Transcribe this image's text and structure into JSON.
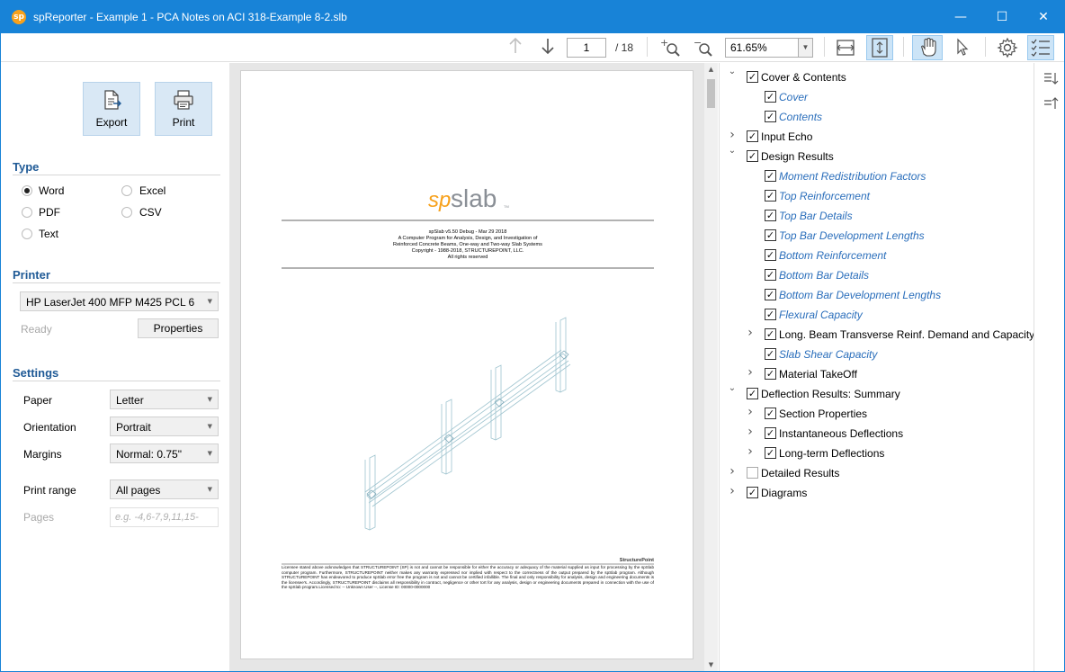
{
  "window": {
    "title": "spReporter - Example 1 - PCA Notes on ACI 318-Example 8-2.slb",
    "app_icon": "sp",
    "minimize": "—",
    "maximize": "☐",
    "close": "✕"
  },
  "toolbar": {
    "page_current": "1",
    "page_total": "/ 18",
    "zoom": "61.65%",
    "icons": [
      "arrow-up-icon",
      "arrow-down-icon",
      "zoom-in-icon",
      "zoom-out-icon",
      "fit-width-icon",
      "fit-page-icon",
      "hand-icon",
      "pointer-icon",
      "gear-icon",
      "checklist-icon"
    ]
  },
  "left": {
    "export_label": "Export",
    "print_label": "Print",
    "type_title": "Type",
    "types": [
      {
        "label": "Word",
        "checked": true
      },
      {
        "label": "Excel",
        "checked": false
      },
      {
        "label": "PDF",
        "checked": false
      },
      {
        "label": "CSV",
        "checked": false
      },
      {
        "label": "Text",
        "checked": false
      }
    ],
    "printer_title": "Printer",
    "printer_name": "HP LaserJet 400 MFP M425 PCL 6",
    "printer_status": "Ready",
    "properties_label": "Properties",
    "settings_title": "Settings",
    "paper_label": "Paper",
    "paper_value": "Letter",
    "orientation_label": "Orientation",
    "orientation_value": "Portrait",
    "margins_label": "Margins",
    "margins_value": "Normal: 0.75\"",
    "print_range_label": "Print range",
    "print_range_value": "All pages",
    "pages_label": "Pages",
    "pages_placeholder": "e.g. -4,6-7,9,11,15-"
  },
  "page_preview": {
    "logo_sp": "sp",
    "logo_slab": "slab",
    "logo_tm": "TM",
    "line1": "spSlab v5.50 Debug - Mar 29 2018",
    "line2": "A Computer Program for Analysis, Design, and Investigation of",
    "line3": "Reinforced Concrete Beams, One-way and Two-way Slab Systems",
    "line4": "Copyright - 1988-2018, STRUCTUREPOINT, LLC.",
    "line5": "All rights reserved",
    "footer_logo": "StructurePoint",
    "disclaimer": "Licensee stated above acknowledges that STRUCTUREPOINT (SP) is not and cannot be responsible for either the accuracy or adequacy of the material supplied as input for processing by the spSlab computer program. Furthermore, STRUCTUREPOINT neither makes any warranty expressed nor implied with respect to the correctness of the output prepared by the spSlab program. Although STRUCTUREPOINT has endeavored to produce spSlab error free the program is not and cannot be certified infallible. The final and only responsibility for analysis, design and engineering documents is the licensee's. Accordingly, STRUCTUREPOINT disclaims all responsibility in contract, negligence or other tort for any analysis, design or engineering documents prepared in connection with the use of the spSlab program.Licensed to: -- Unknown User --, License ID: 00000-0000000"
  },
  "tree": [
    {
      "label": "Cover & Contents",
      "level": 0,
      "chev": "down",
      "checked": true,
      "kind": "parent"
    },
    {
      "label": "Cover",
      "level": 1,
      "chev": "",
      "checked": true,
      "kind": "leaf"
    },
    {
      "label": "Contents",
      "level": 1,
      "chev": "",
      "checked": true,
      "kind": "leaf"
    },
    {
      "label": "Input Echo",
      "level": 0,
      "chev": "right",
      "checked": true,
      "kind": "parent"
    },
    {
      "label": "Design Results",
      "level": 0,
      "chev": "down",
      "checked": true,
      "kind": "parent"
    },
    {
      "label": "Moment Redistribution Factors",
      "level": 1,
      "chev": "",
      "checked": true,
      "kind": "leaf"
    },
    {
      "label": "Top Reinforcement",
      "level": 1,
      "chev": "",
      "checked": true,
      "kind": "leaf"
    },
    {
      "label": "Top Bar Details",
      "level": 1,
      "chev": "",
      "checked": true,
      "kind": "leaf"
    },
    {
      "label": "Top Bar Development Lengths",
      "level": 1,
      "chev": "",
      "checked": true,
      "kind": "leaf"
    },
    {
      "label": "Bottom Reinforcement",
      "level": 1,
      "chev": "",
      "checked": true,
      "kind": "leaf"
    },
    {
      "label": "Bottom Bar Details",
      "level": 1,
      "chev": "",
      "checked": true,
      "kind": "leaf"
    },
    {
      "label": "Bottom Bar Development Lengths",
      "level": 1,
      "chev": "",
      "checked": true,
      "kind": "leaf"
    },
    {
      "label": "Flexural Capacity",
      "level": 1,
      "chev": "",
      "checked": true,
      "kind": "leaf"
    },
    {
      "label": "Long. Beam Transverse Reinf. Demand and Capacity",
      "level": 1,
      "chev": "right",
      "checked": true,
      "kind": "parent"
    },
    {
      "label": "Slab Shear Capacity",
      "level": 1,
      "chev": "",
      "checked": true,
      "kind": "leaf"
    },
    {
      "label": "Material TakeOff",
      "level": 1,
      "chev": "right",
      "checked": true,
      "kind": "parent"
    },
    {
      "label": "Deflection Results: Summary",
      "level": 0,
      "chev": "down",
      "checked": true,
      "kind": "parent"
    },
    {
      "label": "Section Properties",
      "level": 1,
      "chev": "right",
      "checked": true,
      "kind": "parent"
    },
    {
      "label": "Instantaneous Deflections",
      "level": 1,
      "chev": "right",
      "checked": true,
      "kind": "parent"
    },
    {
      "label": "Long-term Deflections",
      "level": 1,
      "chev": "right",
      "checked": true,
      "kind": "parent"
    },
    {
      "label": "Detailed Results",
      "level": 0,
      "chev": "right",
      "checked": false,
      "kind": "parent"
    },
    {
      "label": "Diagrams",
      "level": 0,
      "chev": "right",
      "checked": true,
      "kind": "parent"
    }
  ],
  "side_icons": [
    "sort-descending-icon",
    "sort-ascending-icon"
  ],
  "colors": {
    "accent": "#1883d7",
    "leaf_text": "#2a6ebb",
    "section_title": "#1f5a96",
    "logo_orange": "#f7a11c"
  }
}
